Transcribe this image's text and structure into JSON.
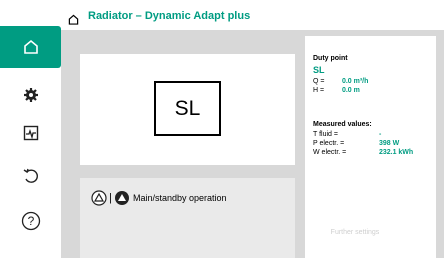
{
  "header": {
    "title": "Radiator – Dynamic Adapt plus",
    "home_icon": "home-icon"
  },
  "sidebar": {
    "items": [
      {
        "icon": "home-icon",
        "active": true
      },
      {
        "icon": "gear-icon",
        "active": false
      },
      {
        "icon": "diagnostics-icon",
        "active": false
      },
      {
        "icon": "undo-icon",
        "active": false
      },
      {
        "icon": "help-icon",
        "active": false
      }
    ]
  },
  "main": {
    "control_mode": "SL",
    "operation": {
      "label": "Main/standby operation",
      "separator": "|",
      "icons": [
        "pump-outline-icon",
        "pump-filled-icon"
      ]
    }
  },
  "duty_point": {
    "title": "Duty point",
    "mode": "SL",
    "rows": [
      {
        "key": "Q =",
        "value": "0.0 m³/h"
      },
      {
        "key": "H =",
        "value": "0.0 m"
      }
    ]
  },
  "measured": {
    "title": "Measured values:",
    "rows": [
      {
        "key": "T fluid =",
        "value": "-"
      },
      {
        "key": "P electr. =",
        "value": "398 W"
      },
      {
        "key": "W electr. =",
        "value": "232.1 kWh"
      }
    ]
  },
  "further_settings": "Further settings",
  "colors": {
    "accent": "#009c82",
    "background": "#d8d8d8",
    "card": "#ffffff"
  }
}
